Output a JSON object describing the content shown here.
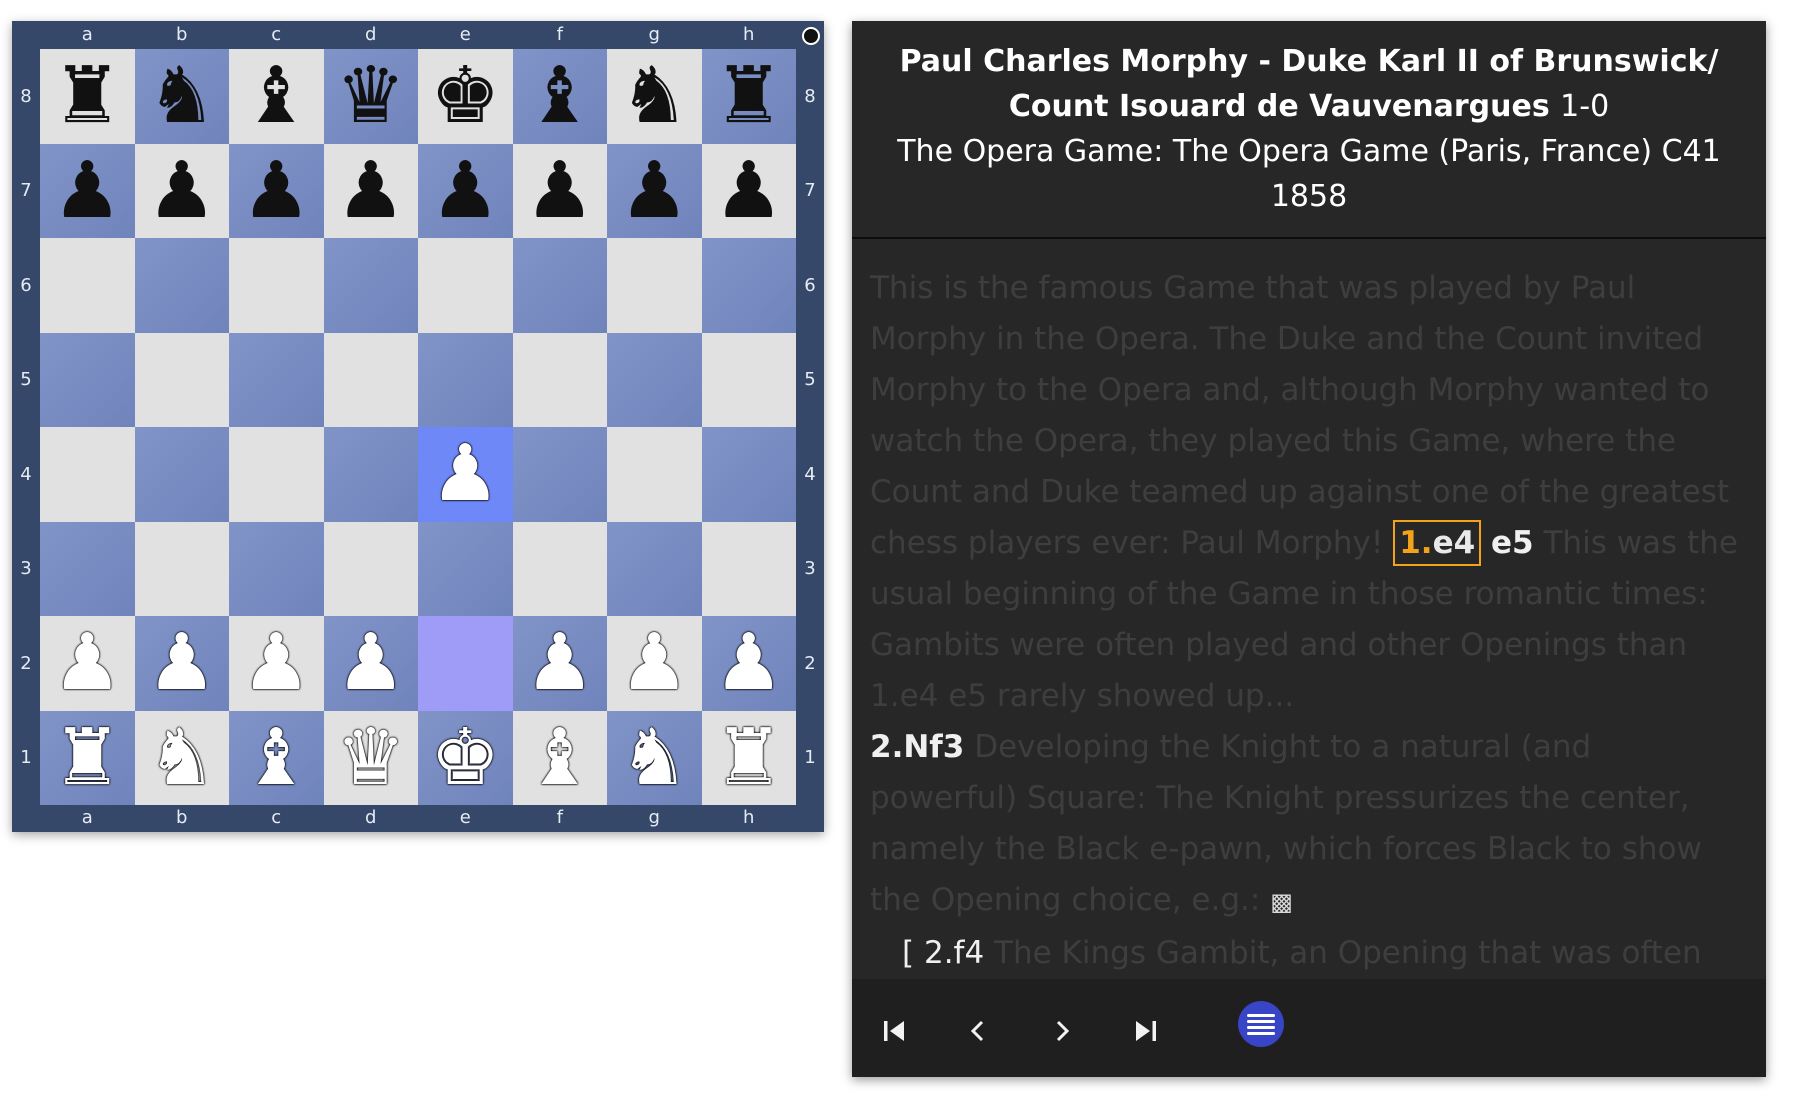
{
  "board": {
    "files": [
      "a",
      "b",
      "c",
      "d",
      "e",
      "f",
      "g",
      "h"
    ],
    "ranks": [
      "8",
      "7",
      "6",
      "5",
      "4",
      "3",
      "2",
      "1"
    ],
    "side_to_move": "black",
    "position": [
      [
        "br",
        "bn",
        "bb",
        "bq",
        "bk",
        "bb",
        "bn",
        "br"
      ],
      [
        "bp",
        "bp",
        "bp",
        "bp",
        "bp",
        "bp",
        "bp",
        "bp"
      ],
      [
        "",
        "",
        "",
        "",
        "",
        "",
        "",
        ""
      ],
      [
        "",
        "",
        "",
        "",
        "",
        "",
        "",
        ""
      ],
      [
        "",
        "",
        "",
        "",
        "wp",
        "",
        "",
        ""
      ],
      [
        "",
        "",
        "",
        "",
        "",
        "",
        "",
        ""
      ],
      [
        "wp",
        "wp",
        "wp",
        "wp",
        "",
        "wp",
        "wp",
        "wp"
      ],
      [
        "wr",
        "wn",
        "wb",
        "wq",
        "wk",
        "wb",
        "wn",
        "wr"
      ]
    ],
    "last_move": {
      "from": "e2",
      "to": "e4"
    },
    "colors": {
      "light": "#e1e1e1",
      "dark": "#7a8dc4",
      "from": "#9f9cf8",
      "to": "#6f88f7",
      "frame": "#35486a"
    }
  },
  "game": {
    "players": "Paul Charles Morphy - Duke Karl II of Brunswick/ Count Isouard de Vauvenargues",
    "result": "1-0",
    "event": "The Opera Game: The Opera Game (Paris, France) C41",
    "year": "1858",
    "intro_comment": "This is the famous Game that was played by Paul Morphy in the Opera. The Duke and the Count invited Morphy to the Opera and, although Morphy wanted to watch the Opera, they played this Game, where the Count and Duke teamed up against one of the greatest chess players ever: Paul Morphy!",
    "move1_num": "1.",
    "move1_white": "e4",
    "move1_black": "e5",
    "comment1": "This was the usual beginning of the Game in those romantic times: Gambits were often played and other Openings than 1.e4 e5 rarely showed up...",
    "move2": "2.Nf3",
    "comment2": "Developing the Knight to a natural (and powerful) Square: The Knight pressurizes the center, namely the Black e-pawn, which forces Black to show the Opening choice, e.g.:",
    "var_open": "[",
    "var_move": "2.f4",
    "var_comment": "The Kings Gambit, an Opening that was often seen in those days. But nowadays it is somewhat refuted and"
  },
  "nav": {
    "buttons": [
      "first-move",
      "previous-move",
      "next-move",
      "last-move",
      "menu"
    ],
    "accent": "#3845c7"
  }
}
